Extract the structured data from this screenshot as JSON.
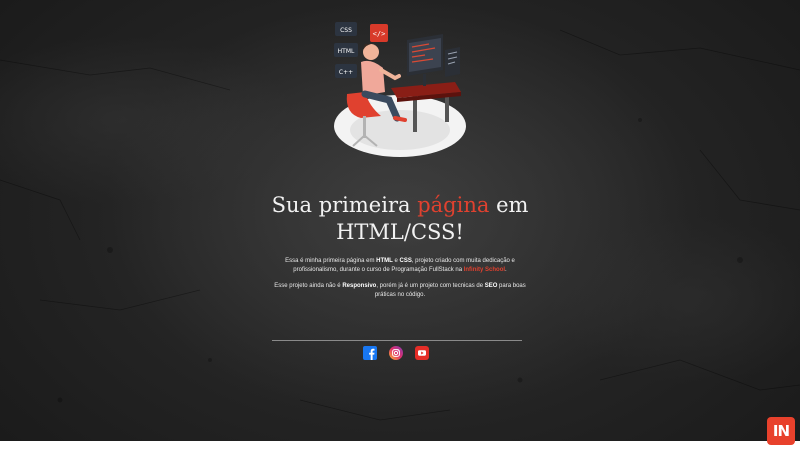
{
  "colors": {
    "accent": "#e0412f",
    "background": "#1c1c1c",
    "text": "#f2f2f2"
  },
  "illustration": {
    "icon": "developer-desk-illustration",
    "tags": [
      "CSS",
      "HTML",
      "C++"
    ],
    "code_icon": "</>"
  },
  "hero": {
    "title_before": "Sua primeira",
    "title_accent": "página",
    "title_after": "em",
    "title_line2": "HTML/CSS!"
  },
  "intro": {
    "t1": "Essa é minha primeira página em ",
    "b1": "HTML",
    "t2": " e ",
    "b2": "CSS",
    "t3": ", projeto criado com muita dedicação e profissionalismo, durante o curso de Programação FullStack na ",
    "link": "Infinity School",
    "t4": "."
  },
  "note": {
    "t1": "Esse projeto ainda não é ",
    "b1": "Responsivo",
    "t2": ", porém já é um projeto com tecnicas de ",
    "b2": "SEO",
    "t3": " para boas práticas no código."
  },
  "footer": {
    "social": [
      {
        "name": "Facebook",
        "icon": "facebook-icon"
      },
      {
        "name": "Instagram",
        "icon": "instagram-icon"
      },
      {
        "name": "YouTube",
        "icon": "youtube-icon"
      }
    ]
  },
  "badge": {
    "label": "IN"
  }
}
